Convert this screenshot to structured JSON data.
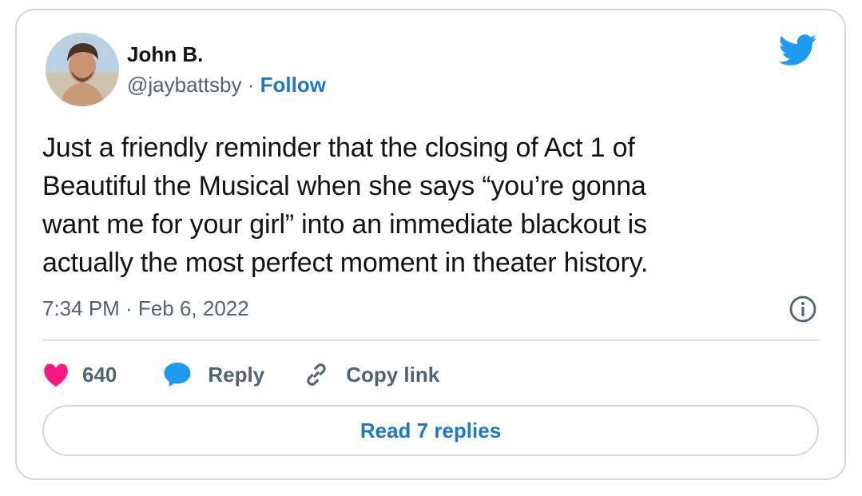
{
  "author": {
    "name": "John B.",
    "handle": "@jaybattsby",
    "separator": "·",
    "follow_label": "Follow"
  },
  "tweet": {
    "lines": [
      "Just a friendly reminder that the closing of Act 1 of",
      "Beautiful the Musical when she says “you’re gonna",
      "want me for your girl” into an immediate blackout is",
      "actually the most perfect moment in theater history."
    ],
    "timestamp": "7:34 PM · Feb 6, 2022"
  },
  "actions": {
    "like_count": "640",
    "reply_label": "Reply",
    "copy_link_label": "Copy link"
  },
  "read_replies_label": "Read 7 replies",
  "icons": {
    "brand": "twitter-bird-icon",
    "info": "info-icon",
    "like": "heart-icon",
    "reply": "speech-bubble-icon",
    "copy": "link-icon"
  },
  "colors": {
    "accent": "#1d9bf0",
    "link_text": "#1d79c4",
    "heart": "#f91880",
    "secondary_text": "#536471",
    "border": "#cfd9de"
  }
}
